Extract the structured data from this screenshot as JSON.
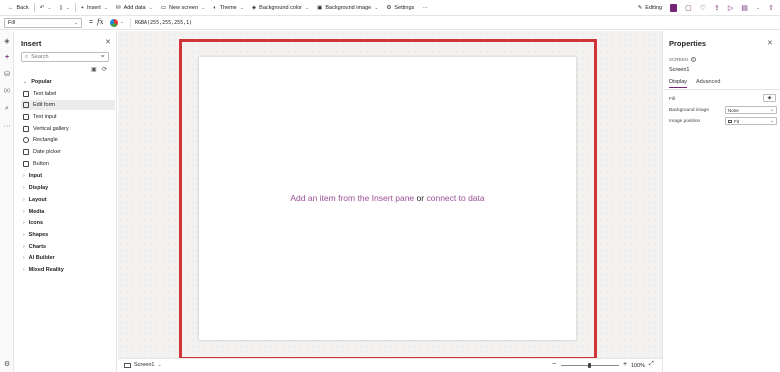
{
  "toolbar": {
    "back": "Back",
    "insert": "Insert",
    "add_data": "Add data",
    "new_screen": "New screen",
    "theme": "Theme",
    "background_color": "Background color",
    "background_image": "Background image",
    "settings": "Settings",
    "more": "···",
    "editing": "Editing"
  },
  "formula": {
    "property": "Fill",
    "equals": "=",
    "fx": "fx",
    "expression": "RGBA(255,255,255,1)"
  },
  "insert_pane": {
    "title": "Insert",
    "search_placeholder": "Search",
    "popular_label": "Popular",
    "popular_items": [
      "Text label",
      "Edit form",
      "Text input",
      "Vertical gallery",
      "Rectangle",
      "Date picker",
      "Button"
    ],
    "categories": [
      "Input",
      "Display",
      "Layout",
      "Media",
      "Icons",
      "Shapes",
      "Charts",
      "AI Builder",
      "Mixed Reality"
    ]
  },
  "canvas": {
    "msg_part1": "Add an item from the Insert pane",
    "msg_or": "or",
    "msg_part2": "connect to data"
  },
  "status": {
    "screen_name": "Screen1",
    "zoom": "100%"
  },
  "properties": {
    "title": "Properties",
    "type_label": "SCREEN",
    "name": "Screen1",
    "tab_display": "Display",
    "tab_advanced": "Advanced",
    "fill_label": "Fill",
    "bg_image_label": "Background image",
    "bg_image_value": "None",
    "image_position_label": "Image position",
    "image_position_value": "Fit"
  },
  "colors": {
    "accent": "#742774",
    "highlight_frame": "#d13438",
    "canvas_text": "#9b4f96"
  }
}
